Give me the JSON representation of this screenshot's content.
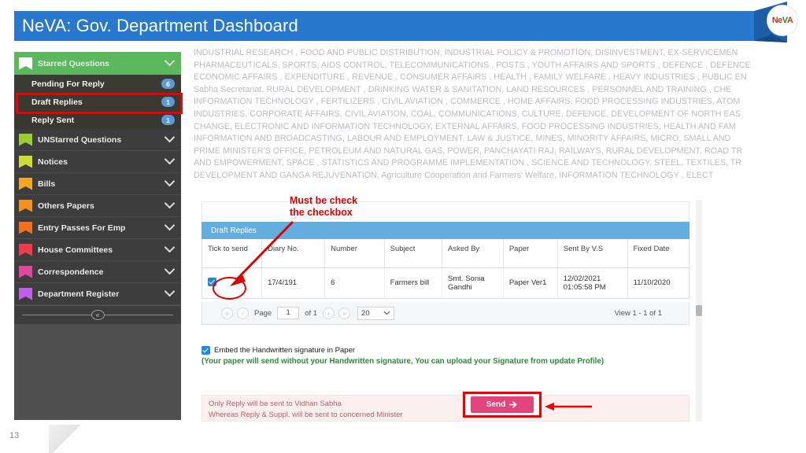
{
  "header": {
    "title": "NeVA: Gov. Department Dashboard",
    "logo": {
      "part1": "Ne",
      "part2": "V",
      "part3": "A"
    },
    "bar_color": "#2878cd"
  },
  "sidebar": {
    "groups": [
      {
        "label": "Starred Questions",
        "icon": "bookmark-icon",
        "accent": "#ffffff",
        "header_bg": "#5cb85c",
        "expanded": true,
        "chevron": "chevron-down-icon",
        "items": [
          {
            "label": "Pending For Reply",
            "badge": "6"
          },
          {
            "label": "Draft Replies",
            "badge": "1",
            "highlighted": true
          },
          {
            "label": "Reply Sent",
            "badge": "1"
          }
        ]
      },
      {
        "label": "UNStarred Questions",
        "icon": "bookmark-icon",
        "accent": "#9acd32",
        "chevron": "chevron-down-icon",
        "items": []
      },
      {
        "label": "Notices",
        "icon": "bookmark-icon",
        "accent": "#cddc39",
        "chevron": "chevron-down-icon",
        "items": []
      },
      {
        "label": "Bills",
        "icon": "bookmark-icon",
        "accent": "#f5a623",
        "chevron": "chevron-down-icon",
        "items": []
      },
      {
        "label": "Others Papers",
        "icon": "bookmark-icon",
        "accent": "#f59120",
        "chevron": "chevron-down-icon",
        "items": []
      },
      {
        "label": "Entry Passes For Emp",
        "icon": "bookmark-icon",
        "accent": "#f4701f",
        "chevron": "chevron-down-icon",
        "items": []
      },
      {
        "label": "House Committees",
        "icon": "bookmark-icon",
        "accent": "#ef3b4e",
        "chevron": "chevron-down-icon",
        "items": []
      },
      {
        "label": "Correspondence",
        "icon": "bookmark-icon",
        "accent": "#e0479e",
        "chevron": "chevron-down-icon",
        "items": []
      },
      {
        "label": "Department Register",
        "icon": "bookmark-icon",
        "accent": "#c060e8",
        "chevron": "chevron-down-icon",
        "items": []
      }
    ],
    "collapse_glyph": "«"
  },
  "background_text": {
    "lines": [
      "INDUSTRIAL RESEARCH , FOOD AND PUBLIC DISTRIBUTION, INDUSTRIAL POLICY & PROMOTION, DISINVESTMENT, EX-SERVICEMEN",
      "PHARMACEUTICALS, SPORTS, AIDS CONTROL, TELECOMMUNICATIONS , POSTS , YOUTH AFFAIRS AND SPORTS , DEFENCE , DEFENCE",
      "ECONOMIC AFFAIRS , EXPENDITURE , REVENUE , CONSUMER AFFAIRS , HEALTH , FAMILY WELFARE , HEAVY INDUSTRIES , PUBLIC EN",
      "Sabha Secretariat, RURAL DEVELOPMENT , DRINKING WATER & SANITATION, LAND RESOURCES , PERSONNEL AND TRAINING , CHE",
      "INFORMATION TECHNOLOGY , FERTILIZERS , CIVIL AVIATION , COMMERCE , HOME AFFAIRS, FOOD PROCESSING INDUSTRIES, ATOM",
      "INDUSTRIES, CORPORATE AFFAIRS, CIVIL AVIATION, COAL, COMMUNICATIONS, CULTURE, DEFENCE, DEVELOPMENT OF NORTH EAS",
      "CHANGE, ELECTRONIC AND INFORMATION TECHNOLOGY, EXTERNAL AFFAIRS, FOOD PROCESSING INDUSTRIES, HEALTH AND FAM",
      "INFORMATION AND BROADCASTING, LABOUR AND EMPLOYMENT, LAW & JUSTICE, MINES, MINORITY AFFAIRS, MICRO, SMALL AND",
      "PRIME MINISTER'S OFFICE, PETROLEUM AND NATURAL GAS, POWER, PANCHAYATI RAJ, RAILWAYS, RURAL DEVELOPMENT, ROAD TR",
      "AND EMPOWERMENT, SPACE , STATISTICS AND PROGRAMME IMPLEMENTATION , SCIENCE AND TECHNOLOGY, STEEL, TEXTILES, TR",
      "DEVELOPMENT AND GANGA REJUVENATION, Agriculture Cooperation and Farmers' Welfare, INFORMATION TECHNOLOGY , ELECT"
    ]
  },
  "annotation": {
    "text_line1": "Must be check",
    "text_line2": "the checkbox",
    "color": "#e00000"
  },
  "grid": {
    "title": "Draft Replies",
    "columns": [
      "Tick to send",
      "Diary No.",
      "Number",
      "Subject",
      "Asked By",
      "Paper",
      "Sent By V.S",
      "Fixed Date"
    ],
    "rows": [
      {
        "checked": true,
        "diary_no": "17/4/191",
        "number": "6",
        "subject": "Farmers bill",
        "asked_by": "Smt. Sonia Gandhi",
        "paper": "Paper Ver1",
        "sent_by_vs": "12/02/2021 01:05:58 PM",
        "fixed_date": "11/10/2020"
      }
    ]
  },
  "pager": {
    "first_glyph": "«",
    "prev_glyph": "‹",
    "page_label": "Page",
    "page_value": "1",
    "of_label": "of 1",
    "next_glyph": "›",
    "last_glyph": "»",
    "page_size": "20",
    "page_size_chevron": "chevron-down-icon",
    "view_text": "View 1 - 1 of 1"
  },
  "signature": {
    "checked": true,
    "label": "Embed the Handwritten signature in Paper",
    "note": "(Your paper will send without your Handwritten signature, You can upload your Signature from update Profile)"
  },
  "notice": {
    "line1": "Only Reply will be sent to Vidhan Sabha",
    "line2": "Whereas Reply & Suppl. will be sent to concerned Minister"
  },
  "send_button": {
    "label": "Send",
    "arrow": "arrow-right-icon",
    "color": "#e0457b"
  },
  "footer": {
    "page_number": "13"
  }
}
